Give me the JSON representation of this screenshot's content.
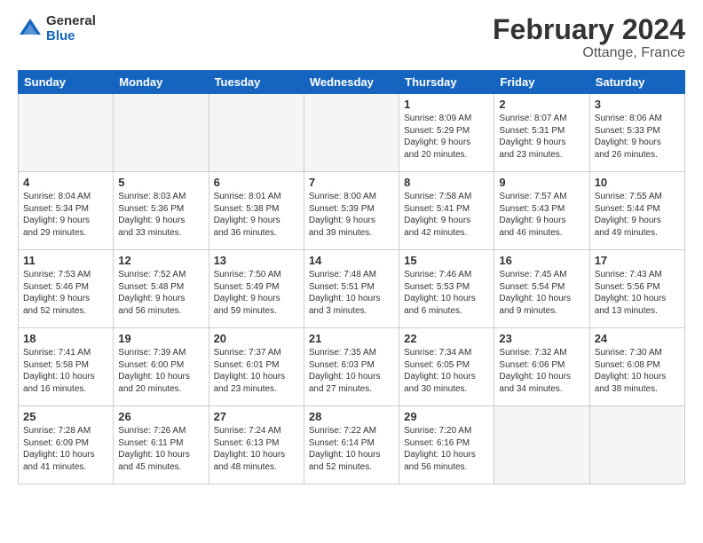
{
  "header": {
    "logo_general": "General",
    "logo_blue": "Blue",
    "month_title": "February 2024",
    "location": "Ottange, France"
  },
  "days_of_week": [
    "Sunday",
    "Monday",
    "Tuesday",
    "Wednesday",
    "Thursday",
    "Friday",
    "Saturday"
  ],
  "weeks": [
    [
      {
        "day": "",
        "info": "",
        "empty": true
      },
      {
        "day": "",
        "info": "",
        "empty": true
      },
      {
        "day": "",
        "info": "",
        "empty": true
      },
      {
        "day": "",
        "info": "",
        "empty": true
      },
      {
        "day": "1",
        "info": "Sunrise: 8:09 AM\nSunset: 5:29 PM\nDaylight: 9 hours\nand 20 minutes.",
        "empty": false
      },
      {
        "day": "2",
        "info": "Sunrise: 8:07 AM\nSunset: 5:31 PM\nDaylight: 9 hours\nand 23 minutes.",
        "empty": false
      },
      {
        "day": "3",
        "info": "Sunrise: 8:06 AM\nSunset: 5:33 PM\nDaylight: 9 hours\nand 26 minutes.",
        "empty": false
      }
    ],
    [
      {
        "day": "4",
        "info": "Sunrise: 8:04 AM\nSunset: 5:34 PM\nDaylight: 9 hours\nand 29 minutes.",
        "empty": false
      },
      {
        "day": "5",
        "info": "Sunrise: 8:03 AM\nSunset: 5:36 PM\nDaylight: 9 hours\nand 33 minutes.",
        "empty": false
      },
      {
        "day": "6",
        "info": "Sunrise: 8:01 AM\nSunset: 5:38 PM\nDaylight: 9 hours\nand 36 minutes.",
        "empty": false
      },
      {
        "day": "7",
        "info": "Sunrise: 8:00 AM\nSunset: 5:39 PM\nDaylight: 9 hours\nand 39 minutes.",
        "empty": false
      },
      {
        "day": "8",
        "info": "Sunrise: 7:58 AM\nSunset: 5:41 PM\nDaylight: 9 hours\nand 42 minutes.",
        "empty": false
      },
      {
        "day": "9",
        "info": "Sunrise: 7:57 AM\nSunset: 5:43 PM\nDaylight: 9 hours\nand 46 minutes.",
        "empty": false
      },
      {
        "day": "10",
        "info": "Sunrise: 7:55 AM\nSunset: 5:44 PM\nDaylight: 9 hours\nand 49 minutes.",
        "empty": false
      }
    ],
    [
      {
        "day": "11",
        "info": "Sunrise: 7:53 AM\nSunset: 5:46 PM\nDaylight: 9 hours\nand 52 minutes.",
        "empty": false
      },
      {
        "day": "12",
        "info": "Sunrise: 7:52 AM\nSunset: 5:48 PM\nDaylight: 9 hours\nand 56 minutes.",
        "empty": false
      },
      {
        "day": "13",
        "info": "Sunrise: 7:50 AM\nSunset: 5:49 PM\nDaylight: 9 hours\nand 59 minutes.",
        "empty": false
      },
      {
        "day": "14",
        "info": "Sunrise: 7:48 AM\nSunset: 5:51 PM\nDaylight: 10 hours\nand 3 minutes.",
        "empty": false
      },
      {
        "day": "15",
        "info": "Sunrise: 7:46 AM\nSunset: 5:53 PM\nDaylight: 10 hours\nand 6 minutes.",
        "empty": false
      },
      {
        "day": "16",
        "info": "Sunrise: 7:45 AM\nSunset: 5:54 PM\nDaylight: 10 hours\nand 9 minutes.",
        "empty": false
      },
      {
        "day": "17",
        "info": "Sunrise: 7:43 AM\nSunset: 5:56 PM\nDaylight: 10 hours\nand 13 minutes.",
        "empty": false
      }
    ],
    [
      {
        "day": "18",
        "info": "Sunrise: 7:41 AM\nSunset: 5:58 PM\nDaylight: 10 hours\nand 16 minutes.",
        "empty": false
      },
      {
        "day": "19",
        "info": "Sunrise: 7:39 AM\nSunset: 6:00 PM\nDaylight: 10 hours\nand 20 minutes.",
        "empty": false
      },
      {
        "day": "20",
        "info": "Sunrise: 7:37 AM\nSunset: 6:01 PM\nDaylight: 10 hours\nand 23 minutes.",
        "empty": false
      },
      {
        "day": "21",
        "info": "Sunrise: 7:35 AM\nSunset: 6:03 PM\nDaylight: 10 hours\nand 27 minutes.",
        "empty": false
      },
      {
        "day": "22",
        "info": "Sunrise: 7:34 AM\nSunset: 6:05 PM\nDaylight: 10 hours\nand 30 minutes.",
        "empty": false
      },
      {
        "day": "23",
        "info": "Sunrise: 7:32 AM\nSunset: 6:06 PM\nDaylight: 10 hours\nand 34 minutes.",
        "empty": false
      },
      {
        "day": "24",
        "info": "Sunrise: 7:30 AM\nSunset: 6:08 PM\nDaylight: 10 hours\nand 38 minutes.",
        "empty": false
      }
    ],
    [
      {
        "day": "25",
        "info": "Sunrise: 7:28 AM\nSunset: 6:09 PM\nDaylight: 10 hours\nand 41 minutes.",
        "empty": false
      },
      {
        "day": "26",
        "info": "Sunrise: 7:26 AM\nSunset: 6:11 PM\nDaylight: 10 hours\nand 45 minutes.",
        "empty": false
      },
      {
        "day": "27",
        "info": "Sunrise: 7:24 AM\nSunset: 6:13 PM\nDaylight: 10 hours\nand 48 minutes.",
        "empty": false
      },
      {
        "day": "28",
        "info": "Sunrise: 7:22 AM\nSunset: 6:14 PM\nDaylight: 10 hours\nand 52 minutes.",
        "empty": false
      },
      {
        "day": "29",
        "info": "Sunrise: 7:20 AM\nSunset: 6:16 PM\nDaylight: 10 hours\nand 56 minutes.",
        "empty": false
      },
      {
        "day": "",
        "info": "",
        "empty": true
      },
      {
        "day": "",
        "info": "",
        "empty": true
      }
    ]
  ]
}
